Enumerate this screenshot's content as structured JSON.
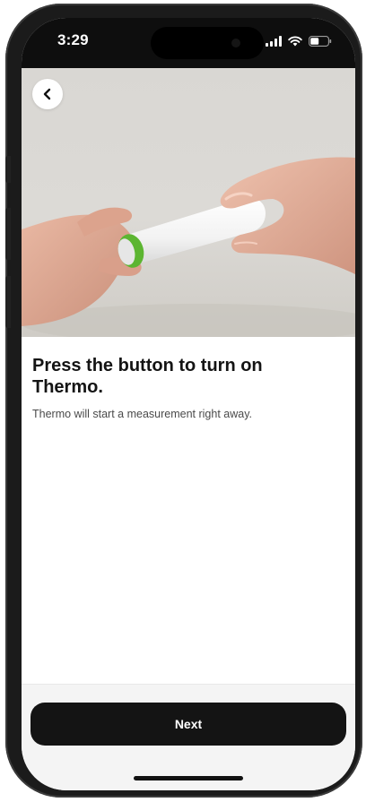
{
  "status_bar": {
    "time": "3:29",
    "icons": [
      "signal-icon",
      "wifi-icon",
      "battery-icon"
    ]
  },
  "hero": {
    "image": "hands-holding-thermometer-photo",
    "back_icon": "chevron-left-icon"
  },
  "content": {
    "title": "Press the button to turn on Thermo.",
    "description": "Thermo will start a measurement right away."
  },
  "footer": {
    "next_label": "Next"
  },
  "colors": {
    "button_bg": "#141414",
    "accent_ring": "#5cb531",
    "page_bg": "#ffffff"
  }
}
